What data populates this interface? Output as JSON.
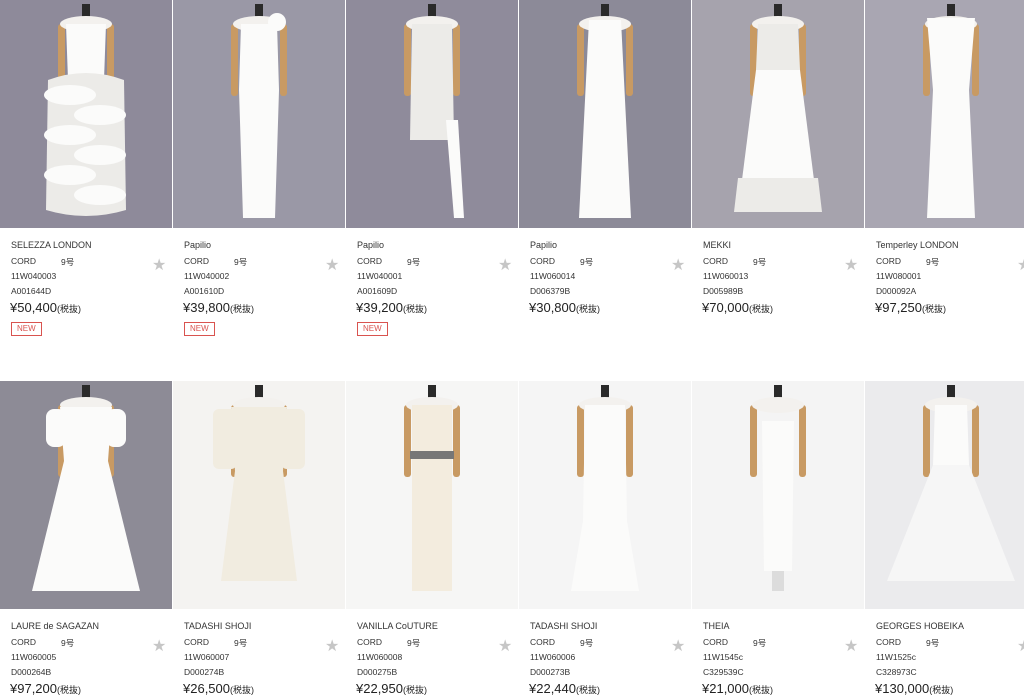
{
  "tax_label": "(税抜)",
  "star_glyph": "★",
  "products": [
    {
      "brand": "SELEZZA LONDON",
      "cord": "CORD",
      "size": "9号",
      "code1": "11W040003",
      "code2": "A001644D",
      "price": "¥50,400",
      "badge": "NEW"
    },
    {
      "brand": "Papilio",
      "cord": "CORD",
      "size": "9号",
      "code1": "11W040002",
      "code2": "A001610D",
      "price": "¥39,800",
      "badge": "NEW"
    },
    {
      "brand": "Papilio",
      "cord": "CORD",
      "size": "9号",
      "code1": "11W040001",
      "code2": "A001609D",
      "price": "¥39,200",
      "badge": "NEW"
    },
    {
      "brand": "Papilio",
      "cord": "CORD",
      "size": "9号",
      "code1": "11W060014",
      "code2": "D006379B",
      "price": "¥30,800",
      "badge": ""
    },
    {
      "brand": "MEKKI",
      "cord": "CORD",
      "size": "9号",
      "code1": "11W060013",
      "code2": "D005989B",
      "price": "¥70,000",
      "badge": ""
    },
    {
      "brand": "Temperley LONDON",
      "cord": "CORD",
      "size": "9号",
      "code1": "11W080001",
      "code2": "D000092A",
      "price": "¥97,250",
      "badge": ""
    },
    {
      "brand": "LAURE de SAGAZAN",
      "cord": "CORD",
      "size": "9号",
      "code1": "11W060005",
      "code2": "D000264B",
      "price": "¥97,200",
      "badge": ""
    },
    {
      "brand": "TADASHI SHOJI",
      "cord": "CORD",
      "size": "9号",
      "code1": "11W060007",
      "code2": "D000274B",
      "price": "¥26,500",
      "badge": ""
    },
    {
      "brand": "VANILLA CoUTURE",
      "cord": "CORD",
      "size": "9号",
      "code1": "11W060008",
      "code2": "D000275B",
      "price": "¥22,950",
      "badge": ""
    },
    {
      "brand": "TADASHI SHOJI",
      "cord": "CORD",
      "size": "9号",
      "code1": "11W060006",
      "code2": "D000273B",
      "price": "¥22,440",
      "badge": ""
    },
    {
      "brand": "THEIA",
      "cord": "CORD",
      "size": "9号",
      "code1": "11W1545c",
      "code2": "C329539C",
      "price": "¥21,000",
      "badge": ""
    },
    {
      "brand": "GEORGES HOBEIKA",
      "cord": "CORD",
      "size": "9号",
      "code1": "11W1525c",
      "code2": "C328973C",
      "price": "¥130,000",
      "badge": ""
    }
  ]
}
